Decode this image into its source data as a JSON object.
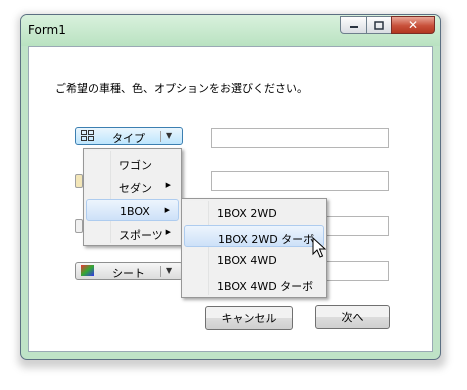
{
  "window": {
    "title": "Form1"
  },
  "caption_buttons": {
    "minimize": "minimize-icon",
    "maximize": "maximize-icon",
    "close": "✕"
  },
  "form": {
    "prompt": "ご希望の車種、色、オプションをお選びください。",
    "dropdowns": [
      {
        "label": "タイプ",
        "icon": "grid-icon"
      },
      {
        "label": "シート",
        "icon": "color-swatch-icon"
      }
    ],
    "buttons": {
      "cancel": "キャンセル",
      "next": "次へ"
    }
  },
  "menus": {
    "main": [
      {
        "label": "ワゴン",
        "submenu": false
      },
      {
        "label": "セダン",
        "submenu": true
      },
      {
        "label": "1BOX",
        "submenu": true,
        "highlighted": true
      },
      {
        "label": "スポーツ",
        "submenu": true
      }
    ],
    "sub": [
      {
        "label": "1BOX 2WD"
      },
      {
        "label": "1BOX 2WD ターボ",
        "highlighted": true
      },
      {
        "label": "1BOX 4WD"
      },
      {
        "label": "1BOX 4WD ターボ"
      }
    ],
    "arrow": "▶"
  },
  "colors": {
    "accent_border": "#3c7fb1",
    "highlight_border": "#aeccef",
    "close_red": "#c8503a",
    "frame": "#bfe3c7"
  }
}
